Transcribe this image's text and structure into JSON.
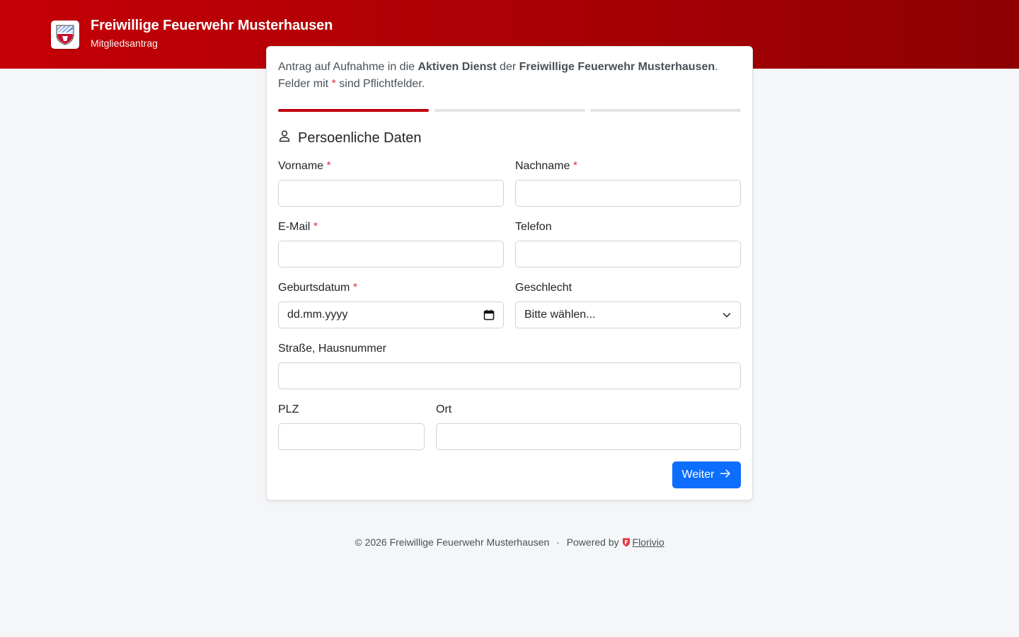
{
  "header": {
    "title": "Freiwillige Feuerwehr Musterhausen",
    "subtitle": "Mitgliedsantrag",
    "logo_icon": "coat-of-arms-icon"
  },
  "intro": {
    "text_1": "Antrag auf Aufnahme in die ",
    "bold_1": "Aktiven Dienst",
    "text_2": " der ",
    "bold_2": "Freiwillige Feuerwehr Musterhausen",
    "text_3": ".",
    "line2_pre": "Felder mit ",
    "line2_star": "*",
    "line2_post": " sind Pflichtfelder."
  },
  "steps": {
    "total": 3,
    "current": 1
  },
  "section": {
    "icon": "person-icon",
    "title": "Persoenliche Daten"
  },
  "fields": {
    "vorname": {
      "label": "Vorname",
      "required": "*",
      "value": ""
    },
    "nachname": {
      "label": "Nachname",
      "required": "*",
      "value": ""
    },
    "email": {
      "label": "E-Mail",
      "required": "*",
      "value": ""
    },
    "telefon": {
      "label": "Telefon",
      "value": ""
    },
    "geburtsdatum": {
      "label": "Geburtsdatum",
      "required": "*",
      "placeholder": "dd.mm.yyyy",
      "icon": "calendar-icon"
    },
    "geschlecht": {
      "label": "Geschlecht",
      "selected": "Bitte wählen...",
      "icon": "chevron-down-icon"
    },
    "strasse": {
      "label": "Straße, Hausnummer",
      "value": ""
    },
    "plz": {
      "label": "PLZ",
      "value": ""
    },
    "ort": {
      "label": "Ort",
      "value": ""
    }
  },
  "next_button": {
    "label": "Weiter",
    "icon": "arrow-right-icon",
    "color": "#0d6efd"
  },
  "footer": {
    "copyright": "© 2026 Freiwillige Feuerwehr Musterhausen",
    "separator": "·",
    "powered_by": "Powered by",
    "brand_icon": "florivio-shield-icon",
    "brand": "Florivio"
  },
  "colors": {
    "brand_red": "#c40006",
    "required": "#dc3545",
    "primary": "#0d6efd"
  }
}
